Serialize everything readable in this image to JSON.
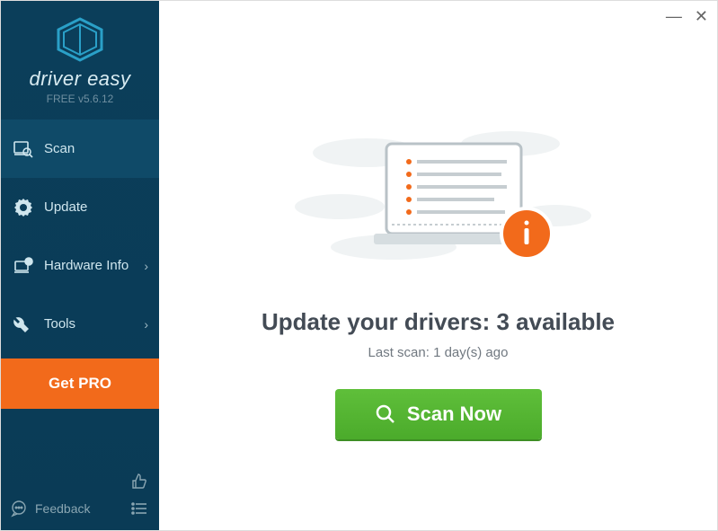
{
  "brand": {
    "name": "driver easy",
    "version_label": "FREE v5.6.12"
  },
  "sidebar": {
    "items": [
      {
        "label": "Scan",
        "icon": "scan",
        "active": true,
        "chevron": false
      },
      {
        "label": "Update",
        "icon": "update",
        "active": false,
        "chevron": false
      },
      {
        "label": "Hardware Info",
        "icon": "hardware",
        "active": false,
        "chevron": true
      },
      {
        "label": "Tools",
        "icon": "tools",
        "active": false,
        "chevron": true
      }
    ],
    "getpro_label": "Get PRO",
    "feedback_label": "Feedback"
  },
  "main": {
    "headline": "Update your drivers: 3 available",
    "available_count": 3,
    "subtext": "Last scan: 1 day(s) ago",
    "last_scan_days": 1,
    "scan_button_label": "Scan Now"
  },
  "colors": {
    "accent_orange": "#f26a1b",
    "scan_green": "#4bab2b",
    "sidebar_bg": "#0b3e5a"
  }
}
